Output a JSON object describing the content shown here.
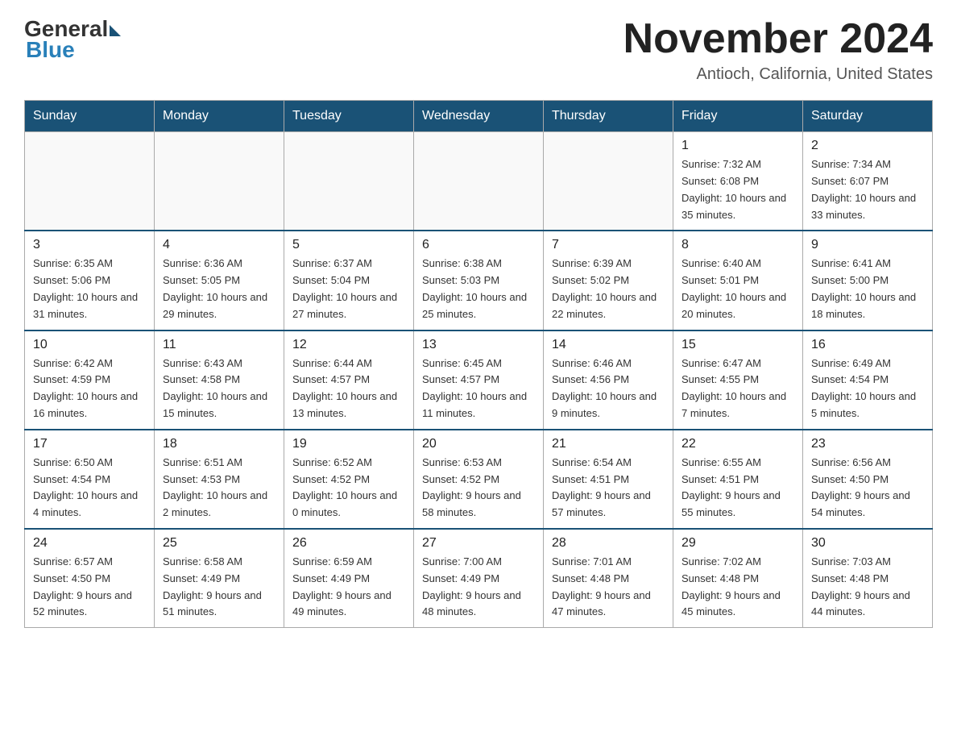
{
  "header": {
    "logo_general": "General",
    "logo_blue": "Blue",
    "month_title": "November 2024",
    "location": "Antioch, California, United States"
  },
  "weekdays": [
    "Sunday",
    "Monday",
    "Tuesday",
    "Wednesday",
    "Thursday",
    "Friday",
    "Saturday"
  ],
  "weeks": [
    [
      {
        "day": "",
        "info": ""
      },
      {
        "day": "",
        "info": ""
      },
      {
        "day": "",
        "info": ""
      },
      {
        "day": "",
        "info": ""
      },
      {
        "day": "",
        "info": ""
      },
      {
        "day": "1",
        "info": "Sunrise: 7:32 AM\nSunset: 6:08 PM\nDaylight: 10 hours and 35 minutes."
      },
      {
        "day": "2",
        "info": "Sunrise: 7:34 AM\nSunset: 6:07 PM\nDaylight: 10 hours and 33 minutes."
      }
    ],
    [
      {
        "day": "3",
        "info": "Sunrise: 6:35 AM\nSunset: 5:06 PM\nDaylight: 10 hours and 31 minutes."
      },
      {
        "day": "4",
        "info": "Sunrise: 6:36 AM\nSunset: 5:05 PM\nDaylight: 10 hours and 29 minutes."
      },
      {
        "day": "5",
        "info": "Sunrise: 6:37 AM\nSunset: 5:04 PM\nDaylight: 10 hours and 27 minutes."
      },
      {
        "day": "6",
        "info": "Sunrise: 6:38 AM\nSunset: 5:03 PM\nDaylight: 10 hours and 25 minutes."
      },
      {
        "day": "7",
        "info": "Sunrise: 6:39 AM\nSunset: 5:02 PM\nDaylight: 10 hours and 22 minutes."
      },
      {
        "day": "8",
        "info": "Sunrise: 6:40 AM\nSunset: 5:01 PM\nDaylight: 10 hours and 20 minutes."
      },
      {
        "day": "9",
        "info": "Sunrise: 6:41 AM\nSunset: 5:00 PM\nDaylight: 10 hours and 18 minutes."
      }
    ],
    [
      {
        "day": "10",
        "info": "Sunrise: 6:42 AM\nSunset: 4:59 PM\nDaylight: 10 hours and 16 minutes."
      },
      {
        "day": "11",
        "info": "Sunrise: 6:43 AM\nSunset: 4:58 PM\nDaylight: 10 hours and 15 minutes."
      },
      {
        "day": "12",
        "info": "Sunrise: 6:44 AM\nSunset: 4:57 PM\nDaylight: 10 hours and 13 minutes."
      },
      {
        "day": "13",
        "info": "Sunrise: 6:45 AM\nSunset: 4:57 PM\nDaylight: 10 hours and 11 minutes."
      },
      {
        "day": "14",
        "info": "Sunrise: 6:46 AM\nSunset: 4:56 PM\nDaylight: 10 hours and 9 minutes."
      },
      {
        "day": "15",
        "info": "Sunrise: 6:47 AM\nSunset: 4:55 PM\nDaylight: 10 hours and 7 minutes."
      },
      {
        "day": "16",
        "info": "Sunrise: 6:49 AM\nSunset: 4:54 PM\nDaylight: 10 hours and 5 minutes."
      }
    ],
    [
      {
        "day": "17",
        "info": "Sunrise: 6:50 AM\nSunset: 4:54 PM\nDaylight: 10 hours and 4 minutes."
      },
      {
        "day": "18",
        "info": "Sunrise: 6:51 AM\nSunset: 4:53 PM\nDaylight: 10 hours and 2 minutes."
      },
      {
        "day": "19",
        "info": "Sunrise: 6:52 AM\nSunset: 4:52 PM\nDaylight: 10 hours and 0 minutes."
      },
      {
        "day": "20",
        "info": "Sunrise: 6:53 AM\nSunset: 4:52 PM\nDaylight: 9 hours and 58 minutes."
      },
      {
        "day": "21",
        "info": "Sunrise: 6:54 AM\nSunset: 4:51 PM\nDaylight: 9 hours and 57 minutes."
      },
      {
        "day": "22",
        "info": "Sunrise: 6:55 AM\nSunset: 4:51 PM\nDaylight: 9 hours and 55 minutes."
      },
      {
        "day": "23",
        "info": "Sunrise: 6:56 AM\nSunset: 4:50 PM\nDaylight: 9 hours and 54 minutes."
      }
    ],
    [
      {
        "day": "24",
        "info": "Sunrise: 6:57 AM\nSunset: 4:50 PM\nDaylight: 9 hours and 52 minutes."
      },
      {
        "day": "25",
        "info": "Sunrise: 6:58 AM\nSunset: 4:49 PM\nDaylight: 9 hours and 51 minutes."
      },
      {
        "day": "26",
        "info": "Sunrise: 6:59 AM\nSunset: 4:49 PM\nDaylight: 9 hours and 49 minutes."
      },
      {
        "day": "27",
        "info": "Sunrise: 7:00 AM\nSunset: 4:49 PM\nDaylight: 9 hours and 48 minutes."
      },
      {
        "day": "28",
        "info": "Sunrise: 7:01 AM\nSunset: 4:48 PM\nDaylight: 9 hours and 47 minutes."
      },
      {
        "day": "29",
        "info": "Sunrise: 7:02 AM\nSunset: 4:48 PM\nDaylight: 9 hours and 45 minutes."
      },
      {
        "day": "30",
        "info": "Sunrise: 7:03 AM\nSunset: 4:48 PM\nDaylight: 9 hours and 44 minutes."
      }
    ]
  ]
}
